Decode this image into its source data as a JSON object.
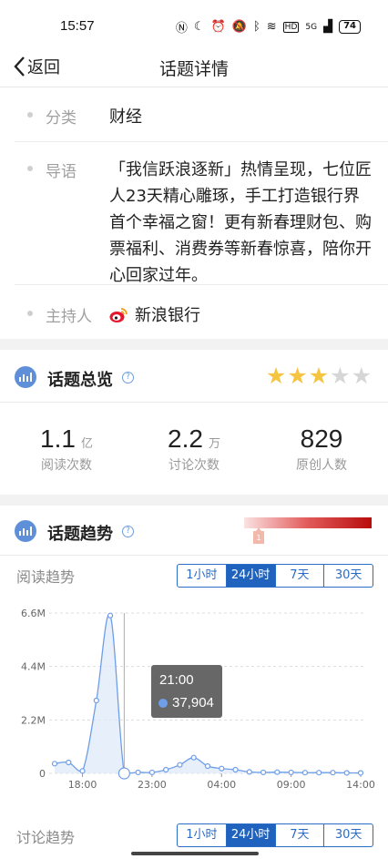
{
  "status_bar": {
    "time": "15:57",
    "icons": [
      "nfc-icon",
      "moon-icon",
      "alarm-icon",
      "mute-icon",
      "bluetooth-icon",
      "wifi-icon",
      "hd-icon",
      "signal-icon"
    ],
    "hd": "HD",
    "network": "5G",
    "battery": "74"
  },
  "nav": {
    "back_label": "返回",
    "title": "话题详情"
  },
  "info": {
    "category_label": "分类",
    "category_value": "财经",
    "intro_label": "导语",
    "intro_text": "「我信跃浪逐新」热情呈现，七位匠人23天精心雕琢，手工打造银行界首个幸福之窗！更有新春理财包、购票福利、消费券等新春惊喜，陪你开心回家过年。",
    "host_label": "主持人",
    "host_value": "新浪银行"
  },
  "overview": {
    "title": "话题总览",
    "help": "?",
    "rating": 3,
    "rating_max": 5,
    "stats": [
      {
        "value": "1.1",
        "unit": "亿",
        "label": "阅读次数"
      },
      {
        "value": "2.2",
        "unit": "万",
        "label": "讨论次数"
      },
      {
        "value": "829",
        "unit": "",
        "label": "原创人数"
      }
    ]
  },
  "trend": {
    "title": "话题趋势",
    "help": "?",
    "heat_marker": "1",
    "read_label": "阅读趋势",
    "discuss_label": "讨论趋势",
    "ranges": [
      "1小时",
      "24小时",
      "7天",
      "30天"
    ],
    "active_range": "24小时"
  },
  "colors": {
    "accent": "#1f63be",
    "line": "#6e9ee8",
    "star": "#f5c542",
    "star_off": "#d6d6d6"
  },
  "chart_data": {
    "type": "area",
    "title": "阅读趋势",
    "x": [
      "16:00",
      "17:00",
      "18:00",
      "19:00",
      "20:00",
      "21:00",
      "22:00",
      "23:00",
      "00:00",
      "01:00",
      "02:00",
      "03:00",
      "04:00",
      "05:00",
      "06:00",
      "07:00",
      "08:00",
      "09:00",
      "10:00",
      "11:00",
      "12:00",
      "13:00",
      "14:00"
    ],
    "series": [
      {
        "values": [
          400000,
          450000,
          100000,
          3000000,
          6500000,
          0,
          37904,
          40000,
          150000,
          350000,
          650000,
          300000,
          200000,
          150000,
          60000,
          40000,
          50000,
          40000,
          30000,
          30000,
          30000,
          20000,
          20000
        ]
      }
    ],
    "x_tick_labels": [
      "18:00",
      "23:00",
      "04:00",
      "09:00",
      "14:00"
    ],
    "y_tick_labels": [
      "6.6M",
      "4.4M",
      "2.2M",
      "0"
    ],
    "ylim": [
      0,
      6600000
    ],
    "tooltip": {
      "time": "21:00",
      "value": "37,904"
    }
  }
}
